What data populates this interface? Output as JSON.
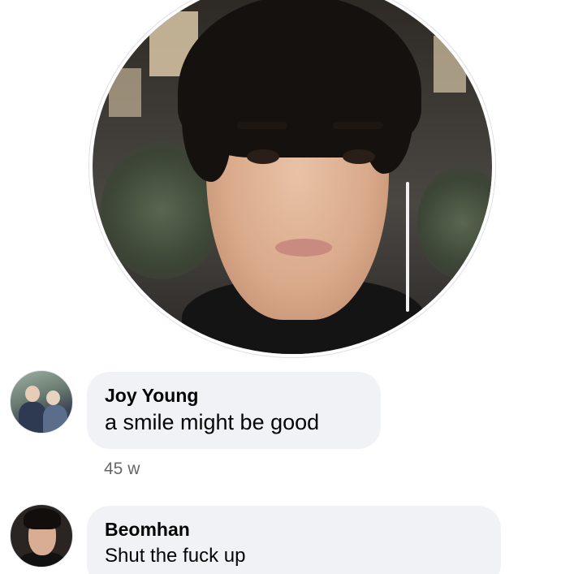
{
  "comments": [
    {
      "author": "Joy Young",
      "text": "a smile might be good",
      "time": "45 w"
    },
    {
      "author": "Beomhan",
      "text": "Shut the fuck up"
    }
  ]
}
